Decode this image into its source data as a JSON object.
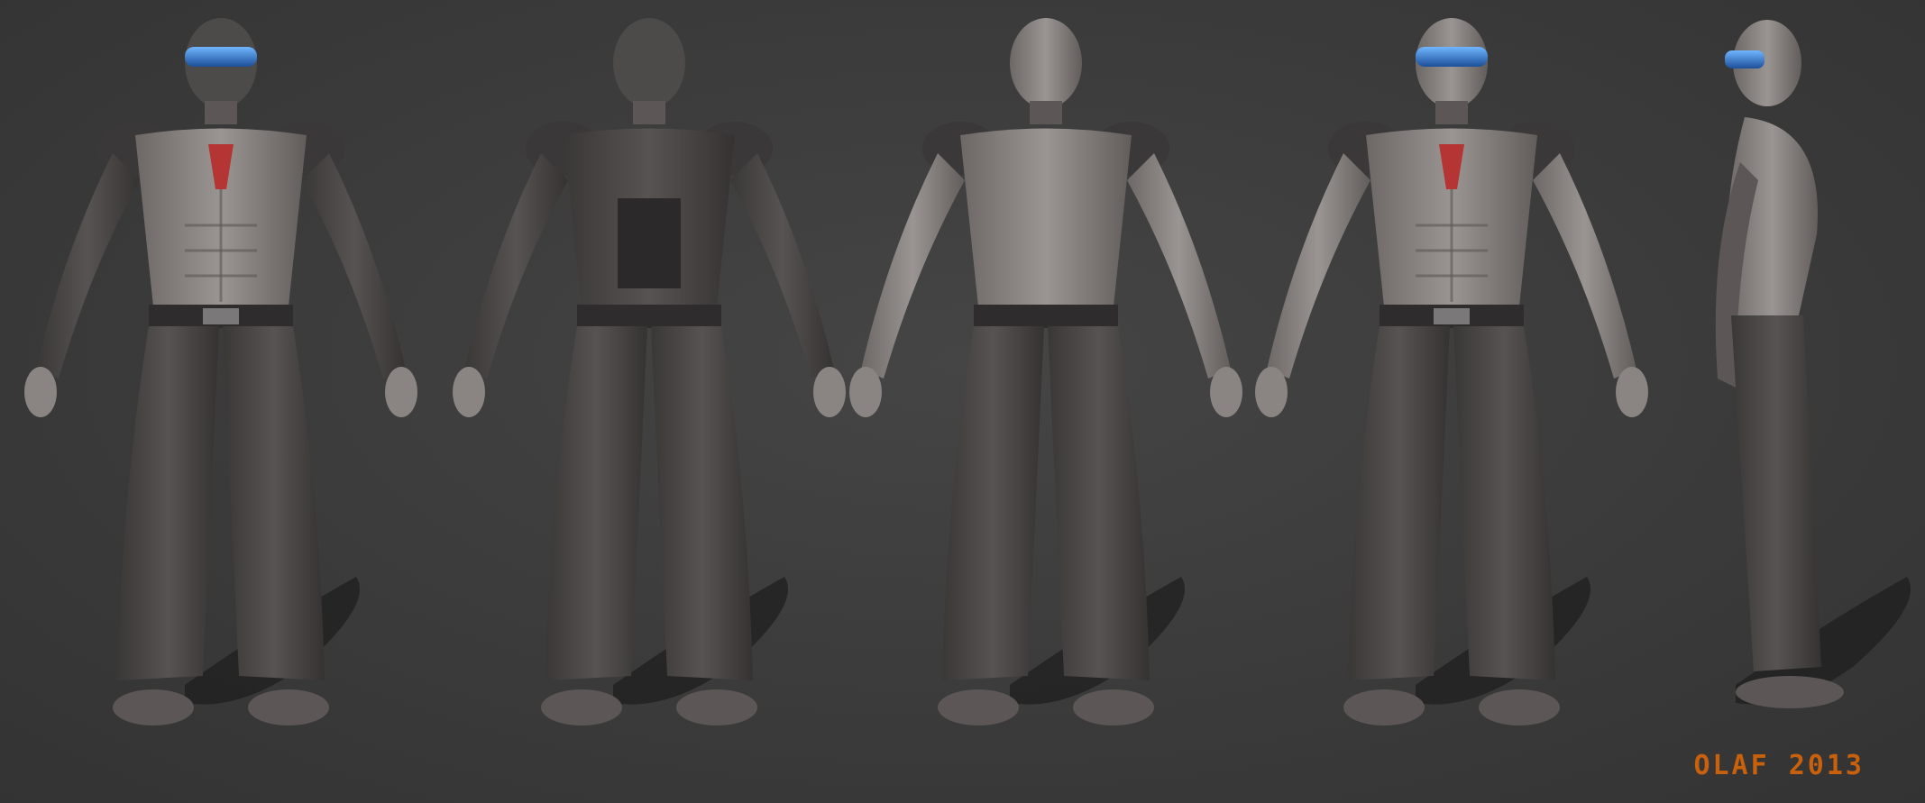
{
  "artwork": {
    "signature": "OLAF 2013",
    "colors": {
      "background": "#3a3a3a",
      "skin": "#8a8582",
      "skin_shadow": "#5c5756",
      "clothing": "#4d4a4a",
      "clothing_dark": "#3a3838",
      "visor": "#2f7fd6",
      "chest_device": "#b53434",
      "signature": "#c8600c",
      "shadow": "#1f1f1f"
    },
    "figures": [
      {
        "view": "front",
        "hood": true
      },
      {
        "view": "back",
        "hood": true
      },
      {
        "view": "back",
        "hood": false
      },
      {
        "view": "front",
        "hood": false
      },
      {
        "view": "side",
        "hood": false
      }
    ]
  }
}
